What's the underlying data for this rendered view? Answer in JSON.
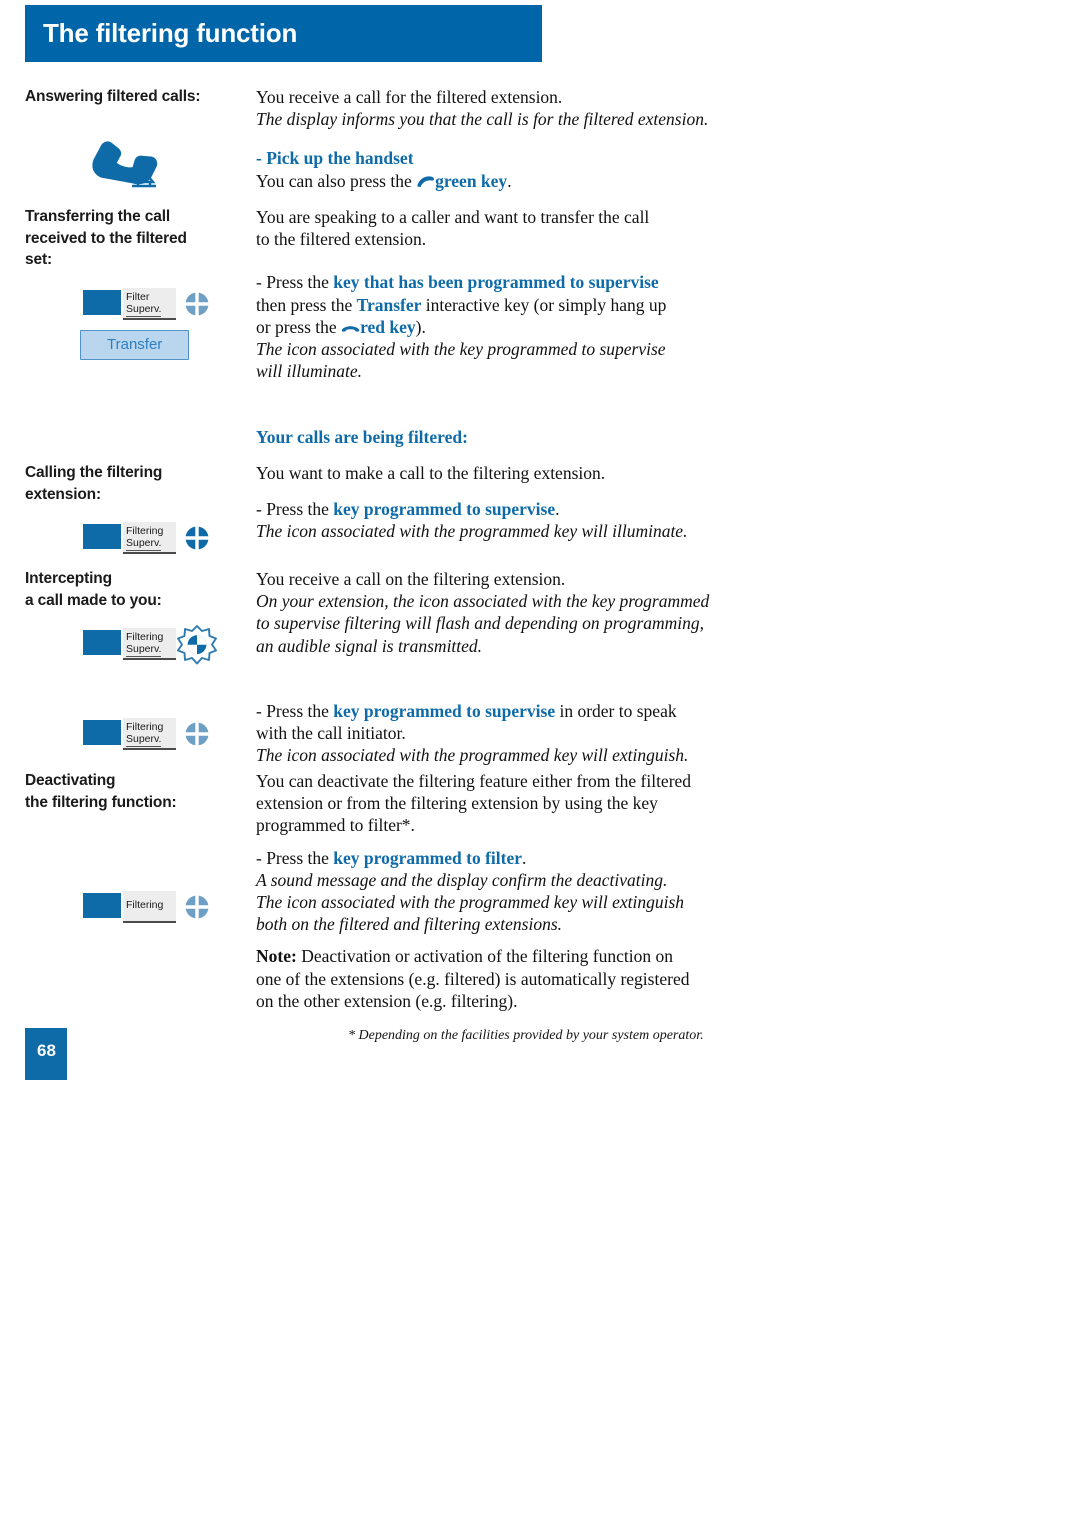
{
  "header": {
    "title": "The filtering function",
    "bar_color": "#0065A9"
  },
  "accent_color": "#0F6BA8",
  "sections": [
    {
      "id": "answering",
      "label": "Answering filtered calls:",
      "icon": "handset-pickup-icon",
      "lines": [
        {
          "style": "plain",
          "text": "You receive a call for the filtered extension."
        },
        {
          "style": "italic",
          "text": "The display informs you that the call is for the filtered extension."
        },
        {
          "style": "blank",
          "text": ""
        },
        {
          "style": "highlight",
          "text": "- Pick up the handset"
        },
        {
          "style": "mixed-green",
          "pre": "You can also press the ",
          "key": "green key",
          "post": "."
        }
      ]
    },
    {
      "id": "transferring",
      "label": "Transferring the call received to the filtered set:",
      "key_figure": {
        "line1": "Filter",
        "line2": "Superv.",
        "icon": "quartered-circle-light-icon"
      },
      "softkey_label": "Transfer",
      "lines": [
        {
          "style": "plain",
          "text": "You are speaking to a caller and want to transfer the call"
        },
        {
          "style": "plain",
          "text": "to the filtered extension."
        },
        {
          "style": "blank",
          "text": ""
        },
        {
          "style": "mixed",
          "pre": "- Press the ",
          "hl": "key that has been programmed to supervise",
          "post": ""
        },
        {
          "style": "mixed",
          "pre": "then press the ",
          "hl": "Transfer",
          "post": " interactive key (or simply hang up"
        },
        {
          "style": "mixed-red",
          "pre": "or press the ",
          "key": "red key",
          "post": ")."
        },
        {
          "style": "italic",
          "text": "The icon associated with the key programmed to supervise"
        },
        {
          "style": "italic",
          "text": "will illuminate."
        }
      ]
    },
    {
      "id": "filtered-heading",
      "heading": "Your calls are being filtered:"
    },
    {
      "id": "calling",
      "label": "Calling the filtering extension:",
      "key_figure": {
        "line1": "Filtering",
        "line2": "Superv.",
        "icon": "quartered-circle-lit-icon"
      },
      "lines": [
        {
          "style": "plain",
          "text": "You want to make a call to the filtering extension."
        },
        {
          "style": "blank",
          "text": ""
        },
        {
          "style": "mixed",
          "pre": "- Press the ",
          "hl": "key programmed to supervise",
          "post": "."
        },
        {
          "style": "italic",
          "text": "The icon associated with the programmed key will illuminate."
        }
      ]
    },
    {
      "id": "intercepting",
      "label": "Intercepting a call made to you:",
      "key_figure": {
        "line1": "Filtering",
        "line2": "Superv.",
        "icon": "quartered-circle-flashing-icon"
      },
      "key_figure_2": {
        "line1": "Filtering",
        "line2": "Superv.",
        "icon": "quartered-circle-light-icon"
      },
      "lines": [
        {
          "style": "plain",
          "text": "You receive a call on the filtering extension."
        },
        {
          "style": "italic",
          "text": "On your extension, the icon associated with the key programmed"
        },
        {
          "style": "italic",
          "text": "to supervise filtering will flash and depending on programming,"
        },
        {
          "style": "italic",
          "text": "an audible signal is transmitted."
        },
        {
          "style": "blank",
          "text": ""
        },
        {
          "style": "mixed",
          "pre": "- Press the ",
          "hl": "key programmed to supervise",
          "post": " in order to speak"
        },
        {
          "style": "plain",
          "text": "with the call initiator."
        },
        {
          "style": "italic",
          "text": "The icon associated with the programmed key will extinguish."
        }
      ]
    },
    {
      "id": "deactivating",
      "label": "Deactivating the filtering function:",
      "key_figure": {
        "line1": "Filtering",
        "line2": "",
        "icon": "quartered-circle-light-icon"
      },
      "lines": [
        {
          "style": "plain",
          "text": "You can deactivate the filtering feature either from the filtered"
        },
        {
          "style": "plain",
          "text": "extension or from the filtering extension by using the key"
        },
        {
          "style": "plain",
          "text": "programmed to filter*."
        },
        {
          "style": "blank",
          "text": ""
        },
        {
          "style": "mixed",
          "pre": "- Press the ",
          "hl": "key programmed to filter",
          "post": "."
        },
        {
          "style": "italic",
          "text": "A sound message and the display confirm the deactivating."
        },
        {
          "style": "italic",
          "text": "The icon associated with the programmed key will extinguish"
        },
        {
          "style": "italic",
          "text": "both on the filtered and filtering extensions."
        },
        {
          "style": "blank",
          "text": ""
        },
        {
          "style": "note",
          "bold": "Note:",
          "text": " Deactivation or activation of the filtering function on"
        },
        {
          "style": "plain",
          "text": "one of the extensions (e.g. filtered) is automatically registered"
        },
        {
          "style": "plain",
          "text": "on the other extension (e.g. filtering)."
        }
      ]
    }
  ],
  "labels": {
    "answering": "Answering filtered calls:",
    "transferring_l1": "Transferring the call",
    "transferring_l2": "received to the filtered",
    "transferring_l3": "set:",
    "calling_l1": "Calling the filtering",
    "calling_l2": "extension:",
    "intercepting_l1": "Intercepting",
    "intercepting_l2": "a call made to you:",
    "deactivating_l1": "Deactivating",
    "deactivating_l2": "the filtering function:"
  },
  "text": {
    "t1": "You receive a call for the filtered extension.",
    "t2": "The display informs you that the call is for the filtered extension.",
    "t3": "- Pick up the handset",
    "t4_pre": "You can also press the ",
    "t4_key": "green key",
    "t4_post": ".",
    "t5": "You are speaking to a caller and want to transfer the call",
    "t6": "to the filtered extension.",
    "t7_pre": "- Press the ",
    "t7_hl": "key that has been programmed to supervise",
    "t8_pre": "then press the ",
    "t8_hl": "Transfer",
    "t8_post": " interactive key (or simply hang up",
    "t9_pre": "or press the ",
    "t9_key": "red key",
    "t9_post": ").",
    "t10": "The icon associated with the key programmed to supervise",
    "t11": "will illuminate.",
    "t12": "Your calls are being filtered:",
    "t13": "You want to make a call to the filtering extension.",
    "t14_pre": "- Press the ",
    "t14_hl": "key programmed to supervise",
    "t14_post": ".",
    "t15": "The icon associated with the programmed key will illuminate.",
    "t16": "You receive a call on the filtering extension.",
    "t17": "On your extension, the icon associated with the key programmed",
    "t18": "to supervise filtering will flash and depending on programming,",
    "t19": "an audible signal is transmitted.",
    "t20_pre": "- Press the ",
    "t20_hl": "key programmed to supervise",
    "t20_post": " in order to speak",
    "t21": "with the call initiator.",
    "t22": "The icon associated with the programmed key will extinguish.",
    "t23": "You can deactivate the filtering feature either from the filtered",
    "t24": "extension or from the filtering extension by using the key",
    "t25": "programmed to filter*.",
    "t26_pre": "- Press the ",
    "t26_hl": "key programmed to filter",
    "t26_post": ".",
    "t27": "A sound message and the display confirm the deactivating.",
    "t28": "The icon associated with the programmed key will extinguish",
    "t29": "both on the filtered and filtering extensions.",
    "t30_bold": "Note:",
    "t30": " Deactivation or activation of the filtering function on",
    "t31": "one of the extensions (e.g. filtered) is automatically registered",
    "t32": "on the other extension (e.g. filtering)."
  },
  "keyfigs": {
    "k1_l1": "Filter",
    "k1_l2": "Superv.",
    "k2_l1": "Filtering",
    "k2_l2": "Superv.",
    "k3_l1": "Filtering",
    "k3_l2": "Superv.",
    "k4_l1": "Filtering",
    "k4_l2": "Superv.",
    "k5_l1": "Filtering"
  },
  "softkey": {
    "transfer_label": "Transfer"
  },
  "footer": {
    "page_number": "68",
    "footnote": "* Depending on the facilities provided by your system operator."
  }
}
